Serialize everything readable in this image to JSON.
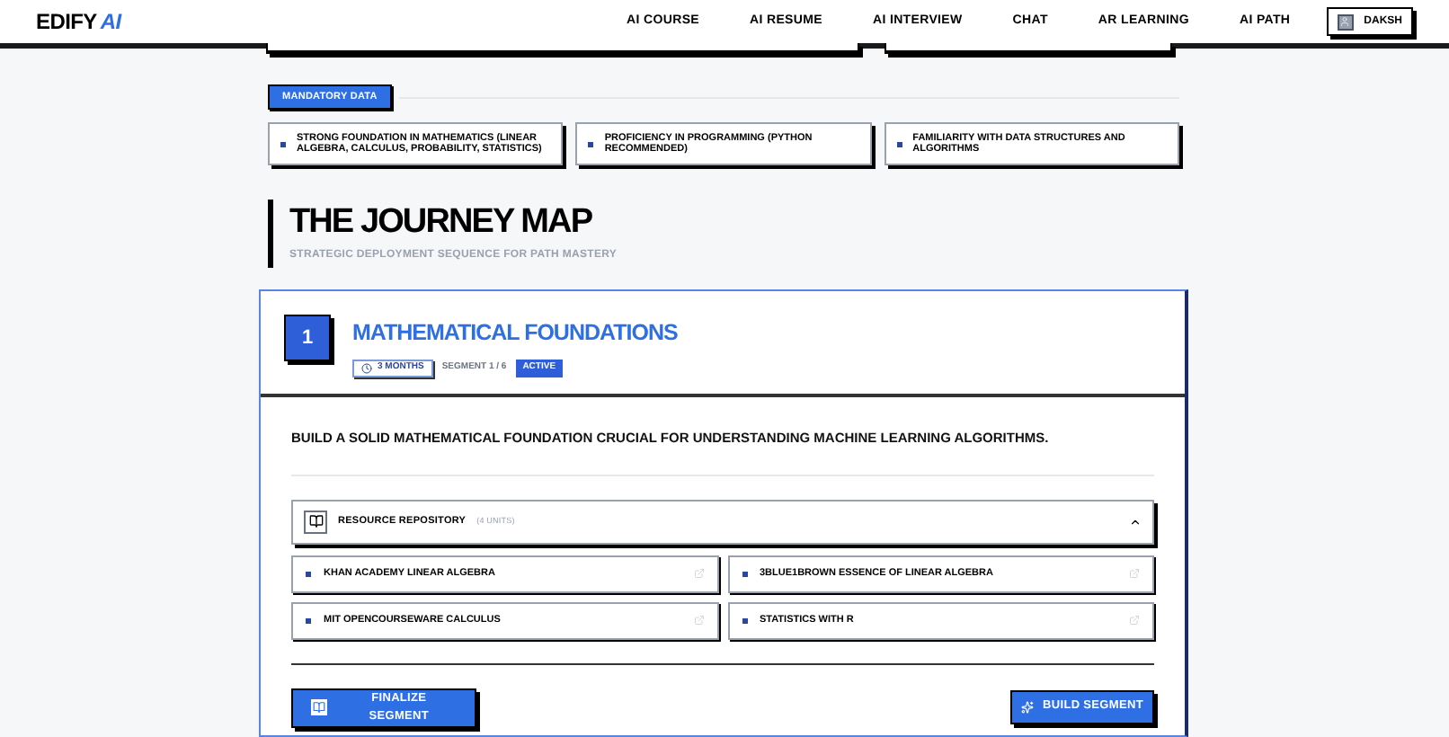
{
  "nav": {
    "logo": "EDIFY",
    "logo_accent": "AI",
    "links": [
      {
        "label": "AI COURSE",
        "selected": false
      },
      {
        "label": "AI RESUME",
        "selected": false
      },
      {
        "label": "AI INTERVIEW",
        "selected": false
      },
      {
        "label": "CHAT",
        "selected": false
      },
      {
        "label": "AR LEARNING",
        "selected": false
      },
      {
        "label": "AI PATH",
        "selected": false
      }
    ],
    "user": "DAKSH"
  },
  "mandatory": {
    "badge": "MANDATORY DATA",
    "items": [
      "STRONG FOUNDATION IN MATHEMATICS (LINEAR ALGEBRA, CALCULUS, PROBABILITY, STATISTICS)",
      "PROFICIENCY IN PROGRAMMING (PYTHON RECOMMENDED)",
      "FAMILIARITY WITH DATA STRUCTURES AND ALGORITHMS"
    ]
  },
  "journey": {
    "title": "THE JOURNEY MAP",
    "subtitle": "STRATEGIC DEPLOYMENT SEQUENCE FOR PATH MASTERY"
  },
  "segment": {
    "number": "1",
    "title": "MATHEMATICAL FOUNDATIONS",
    "duration": "3 MONTHS",
    "position": "SEGMENT 1 / 6",
    "status": "ACTIVE",
    "description": "BUILD A SOLID MATHEMATICAL FOUNDATION CRUCIAL FOR UNDERSTANDING MACHINE LEARNING ALGORITHMS.",
    "repository": {
      "title": "RESOURCE REPOSITORY",
      "count": "(4 UNITS)",
      "expanded": true,
      "resources": [
        "KHAN ACADEMY LINEAR ALGEBRA",
        "3BLUE1BROWN ESSENCE OF LINEAR ALGEBRA",
        "MIT OPENCOURSEWARE CALCULUS",
        "STATISTICS WITH R"
      ]
    },
    "finalize_button": "FINALIZE SEGMENT",
    "build_button": "BUILD SEGMENT"
  }
}
